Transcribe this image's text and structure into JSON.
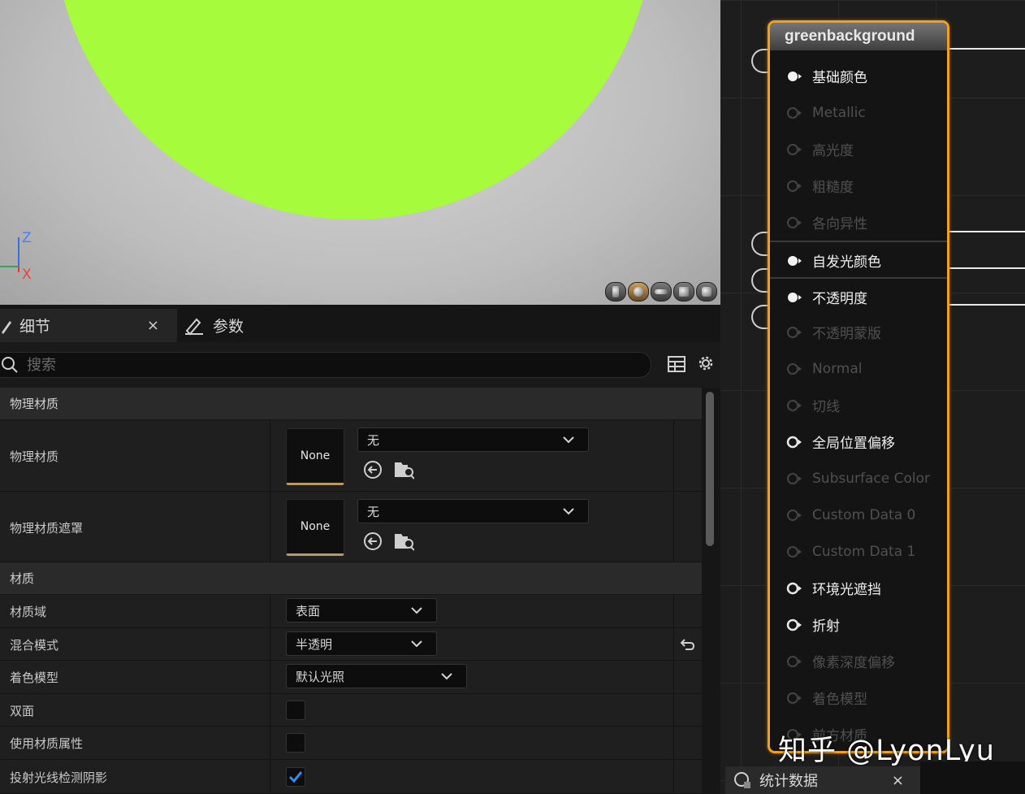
{
  "viewport": {
    "axis_z": "Z",
    "axis_x": "X",
    "sphere_color": "#a6fb3c",
    "view_mode_icons": [
      "cylinder-icon",
      "sphere-icon",
      "plane-icon",
      "cube-icon",
      "teapot-icon"
    ]
  },
  "tabs": [
    {
      "label": "细节",
      "icon": "pencil-icon",
      "close": "×"
    },
    {
      "label": "参数",
      "icon": "pencil-edit-icon"
    }
  ],
  "search": {
    "placeholder": "搜索"
  },
  "categories": {
    "physical": "物理材质",
    "material": "材质"
  },
  "physical_rows": [
    {
      "label": "物理材质",
      "thumb": "None",
      "combo": "无"
    },
    {
      "label": "物理材质遮罩",
      "thumb": "None",
      "combo": "无"
    }
  ],
  "material_rows": {
    "domain": {
      "label": "材质域",
      "value": "表面"
    },
    "blend": {
      "label": "混合模式",
      "value": "半透明"
    },
    "shading": {
      "label": "着色模型",
      "value": "默认光照"
    },
    "two_sided": {
      "label": "双面",
      "checked": false
    },
    "use_attrs": {
      "label": "使用材质属性",
      "checked": false
    },
    "raytrace_shadow": {
      "label": "投射光线检测阴影",
      "checked": true
    }
  },
  "node": {
    "title": "greenbackground",
    "border_color": "#f0a020",
    "pins": [
      {
        "label": "基础颜色",
        "state": "connected"
      },
      {
        "label": "Metallic",
        "state": "disabled"
      },
      {
        "label": "高光度",
        "state": "disabled"
      },
      {
        "label": "粗糙度",
        "state": "disabled"
      },
      {
        "label": "各向异性",
        "state": "disabled"
      },
      {
        "label": "自发光颜色",
        "state": "connected"
      },
      {
        "label": "不透明度",
        "state": "connected"
      },
      {
        "label": "不透明蒙版",
        "state": "disabled"
      },
      {
        "label": "Normal",
        "state": "disabled"
      },
      {
        "label": "切线",
        "state": "disabled"
      },
      {
        "label": "全局位置偏移",
        "state": "enabled"
      },
      {
        "label": "Subsurface Color",
        "state": "disabled"
      },
      {
        "label": "Custom Data 0",
        "state": "disabled"
      },
      {
        "label": "Custom Data 1",
        "state": "disabled"
      },
      {
        "label": "环境光遮挡",
        "state": "enabled"
      },
      {
        "label": "折射",
        "state": "enabled"
      },
      {
        "label": "像素深度偏移",
        "state": "disabled"
      },
      {
        "label": "着色模型",
        "state": "disabled"
      },
      {
        "label": "前方材质",
        "state": "disabled"
      }
    ]
  },
  "watermark": "知乎 @LyonLyu",
  "stats_tab": {
    "label": "统计数据",
    "close": "×"
  }
}
